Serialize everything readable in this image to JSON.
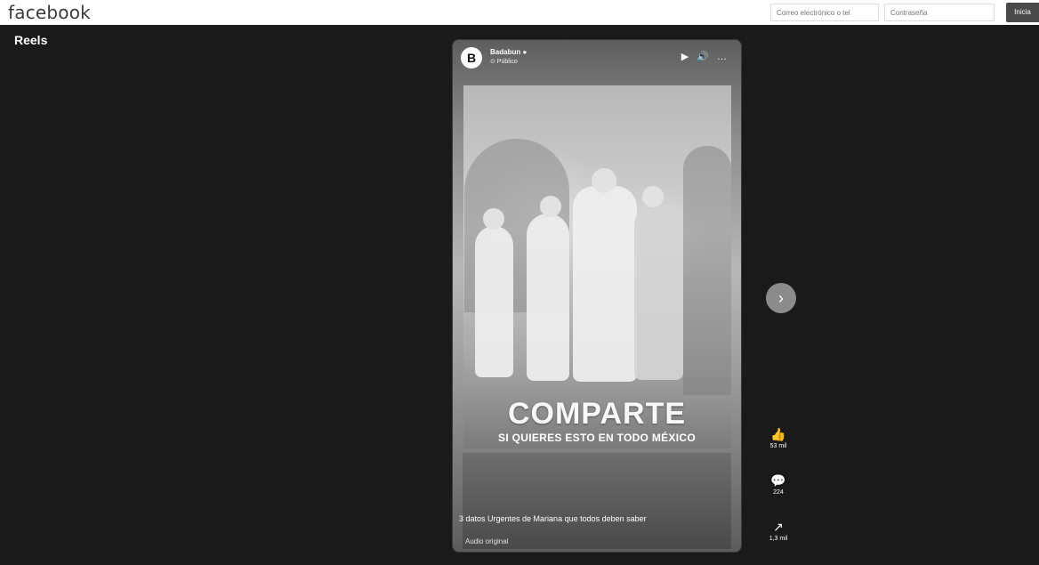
{
  "header": {
    "logo": "facebook",
    "email_placeholder": "Correo electrónico o tel",
    "password_placeholder": "Contraseña",
    "login_label": "Inicia"
  },
  "reels": {
    "section_label": "Reels",
    "page": {
      "avatar_letter": "B",
      "name": "Badabun ●",
      "privacy": "⊙ Público"
    },
    "headline": "COMPARTE",
    "subheadline": "SI QUIERES ESTO EN TODO MÉXICO",
    "caption": "3 datos Urgentes de Mariana que todos deben saber",
    "audio": "Audio original",
    "controls": "▶ 🔊 …"
  },
  "actions": {
    "likes": "53 mil",
    "comments": "224",
    "shares": "1,3 mil"
  },
  "colors": {
    "background": "#1b1a1a",
    "accent": "#4a4a4a"
  },
  "icons": {
    "like": "thumbs-up-icon",
    "comment": "comment-icon",
    "share": "share-icon",
    "next": "chevron-right-icon"
  }
}
